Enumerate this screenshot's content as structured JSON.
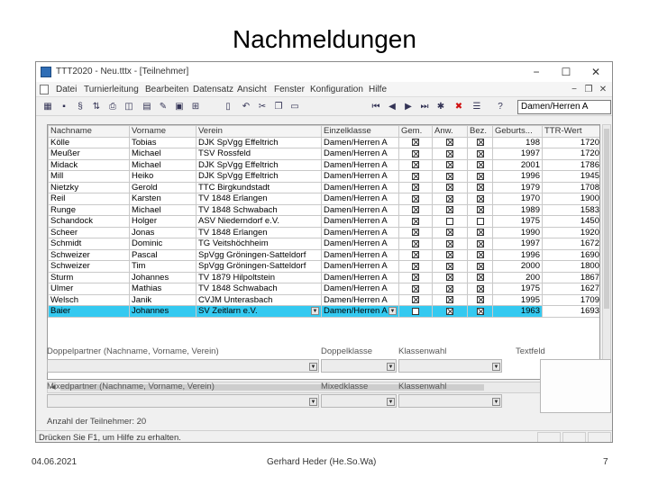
{
  "slide": {
    "title": "Nachmeldungen",
    "footer_date": "04.06.2021",
    "footer_author": "Gerhard Heder (He.So.Wa)",
    "footer_page": "7"
  },
  "window": {
    "title": "TTT2020 - Neu.tttx - [Teilnehmer]",
    "controls": {
      "minimize": "−",
      "maximize": "☐",
      "close": "✕"
    }
  },
  "menu": {
    "items": [
      "Datei",
      "Turnierleitung",
      "Bearbeiten",
      "Datensatz",
      "Ansicht",
      "Fenster",
      "Konfiguration",
      "Hilfe"
    ],
    "mdi": {
      "minimize": "−",
      "restore": "❐",
      "close": "✕"
    }
  },
  "toolbar": {
    "icons": [
      "grid-icon",
      "save-icon",
      "spell-icon",
      "sort-icon",
      "print-icon",
      "preview-icon",
      "table-icon",
      "edit-icon",
      "form-icon",
      "tree-icon",
      "page-icon",
      "undo-icon",
      "cut-icon",
      "copy-icon",
      "paste-icon",
      "first-icon",
      "prev-icon",
      "next-icon",
      "last-icon",
      "new-record-icon",
      "delete-icon",
      "list-icon",
      "help-icon"
    ],
    "combo_value": "Damen/Herren A"
  },
  "table": {
    "columns": [
      "Nachname",
      "Vorname",
      "Verein",
      "Einzelklasse",
      "Gem.",
      "Anw.",
      "Bez.",
      "Geburts...",
      "TTR-Wert"
    ],
    "rows": [
      {
        "nachname": "Kölle",
        "vorname": "Tobias",
        "verein": "DJK SpVgg Effeltrich",
        "klasse": "Damen/Herren A",
        "gem": true,
        "anw": true,
        "bez": true,
        "geburt": "198",
        "ttr": "1720"
      },
      {
        "nachname": "Meußer",
        "vorname": "Michael",
        "verein": "TSV Rossfeld",
        "klasse": "Damen/Herren A",
        "gem": true,
        "anw": true,
        "bez": true,
        "geburt": "1997",
        "ttr": "1720"
      },
      {
        "nachname": "Midack",
        "vorname": "Michael",
        "verein": "DJK SpVgg Effeltrich",
        "klasse": "Damen/Herren A",
        "gem": true,
        "anw": true,
        "bez": true,
        "geburt": "2001",
        "ttr": "1786"
      },
      {
        "nachname": "Mill",
        "vorname": "Heiko",
        "verein": "DJK SpVgg Effeltrich",
        "klasse": "Damen/Herren A",
        "gem": true,
        "anw": true,
        "bez": true,
        "geburt": "1996",
        "ttr": "1945"
      },
      {
        "nachname": "Nietzky",
        "vorname": "Gerold",
        "verein": "TTC Birgkundstadt",
        "klasse": "Damen/Herren A",
        "gem": true,
        "anw": true,
        "bez": true,
        "geburt": "1979",
        "ttr": "1708"
      },
      {
        "nachname": "Reil",
        "vorname": "Karsten",
        "verein": "TV 1848 Erlangen",
        "klasse": "Damen/Herren A",
        "gem": true,
        "anw": true,
        "bez": true,
        "geburt": "1970",
        "ttr": "1900"
      },
      {
        "nachname": "Runge",
        "vorname": "Michael",
        "verein": "TV 1848 Schwabach",
        "klasse": "Damen/Herren A",
        "gem": true,
        "anw": true,
        "bez": true,
        "geburt": "1989",
        "ttr": "1583"
      },
      {
        "nachname": "Schandock",
        "vorname": "Holger",
        "verein": "ASV Niederndorf e.V.",
        "klasse": "Damen/Herren A",
        "gem": true,
        "anw": false,
        "bez": false,
        "geburt": "1975",
        "ttr": "1450"
      },
      {
        "nachname": "Scheer",
        "vorname": "Jonas",
        "verein": "TV 1848 Erlangen",
        "klasse": "Damen/Herren A",
        "gem": true,
        "anw": true,
        "bez": true,
        "geburt": "1990",
        "ttr": "1920"
      },
      {
        "nachname": "Schmidt",
        "vorname": "Dominic",
        "verein": "TG Veitshöchheim",
        "klasse": "Damen/Herren A",
        "gem": true,
        "anw": true,
        "bez": true,
        "geburt": "1997",
        "ttr": "1672"
      },
      {
        "nachname": "Schweizer",
        "vorname": "Pascal",
        "verein": "SpVgg Gröningen-Satteldorf",
        "klasse": "Damen/Herren A",
        "gem": true,
        "anw": true,
        "bez": true,
        "geburt": "1996",
        "ttr": "1690"
      },
      {
        "nachname": "Schweizer",
        "vorname": "Tim",
        "verein": "SpVgg Gröningen-Satteldorf",
        "klasse": "Damen/Herren A",
        "gem": true,
        "anw": true,
        "bez": true,
        "geburt": "2000",
        "ttr": "1800"
      },
      {
        "nachname": "Sturm",
        "vorname": "Johannes",
        "verein": "TV 1879 Hilpoltstein",
        "klasse": "Damen/Herren A",
        "gem": true,
        "anw": true,
        "bez": true,
        "geburt": "200",
        "ttr": "1867"
      },
      {
        "nachname": "Ulmer",
        "vorname": "Mathias",
        "verein": "TV 1848 Schwabach",
        "klasse": "Damen/Herren A",
        "gem": true,
        "anw": true,
        "bez": true,
        "geburt": "1975",
        "ttr": "1627"
      },
      {
        "nachname": "Welsch",
        "vorname": "Janik",
        "verein": "CVJM Unterasbach",
        "klasse": "Damen/Herren A",
        "gem": true,
        "anw": true,
        "bez": true,
        "geburt": "1995",
        "ttr": "1709"
      }
    ],
    "selected_row": {
      "nachname": "Baier",
      "vorname": "Johannes",
      "verein": "SV Zeitlarn e.V.",
      "klasse": "Damen/Herren A",
      "gem": false,
      "anw": true,
      "bez": true,
      "geburt": "1963",
      "ttr": "1693"
    }
  },
  "form": {
    "doppelpartner_label": "Doppelpartner (Nachname, Vorname, Verein)",
    "doppelklasse_label": "Doppelklasse",
    "klassenwahl_label": "Klassenwahl",
    "textfeld_label": "Textfeld",
    "mixedpartner_label": "Mixedpartner (Nachname, Vorname, Verein)",
    "mixedklasse_label": "Mixedklasse",
    "klassenwahl2_label": "Klassenwahl",
    "count_text": "Anzahl der Teilnehmer: 20"
  },
  "status": {
    "text": "Drücken Sie F1, um Hilfe zu erhalten."
  },
  "colors": {
    "selection": "#34c9f0",
    "delete": "#d01010"
  }
}
